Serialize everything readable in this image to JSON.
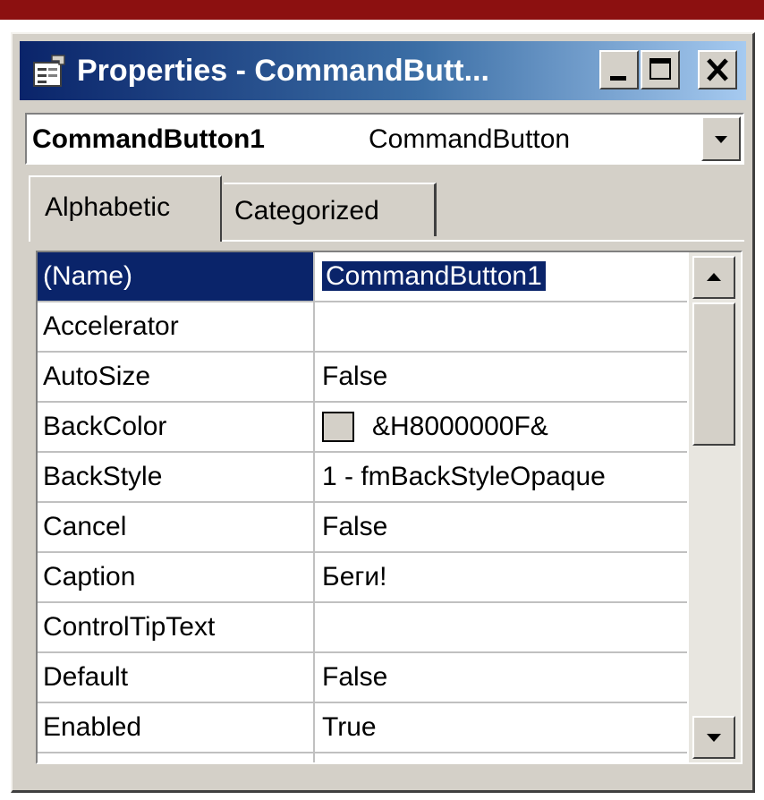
{
  "window": {
    "title": "Properties - CommandButt...",
    "controls": [
      "minimize-icon",
      "maximize-icon",
      "close-icon"
    ]
  },
  "object_selector": {
    "name": "CommandButton1",
    "type": "CommandButton"
  },
  "tabs": [
    {
      "label": "Alphabetic",
      "active": true
    },
    {
      "label": "Categorized",
      "active": false
    }
  ],
  "properties": [
    {
      "name": "(Name)",
      "value": "CommandButton1"
    },
    {
      "name": "Accelerator",
      "value": ""
    },
    {
      "name": "AutoSize",
      "value": "False"
    },
    {
      "name": "BackColor",
      "value": "&H8000000F&"
    },
    {
      "name": "BackStyle",
      "value": "1 - fmBackStyleOpaque"
    },
    {
      "name": "Cancel",
      "value": "False"
    },
    {
      "name": "Caption",
      "value": "Беги!"
    },
    {
      "name": "ControlTipText",
      "value": ""
    },
    {
      "name": "Default",
      "value": "False"
    },
    {
      "name": "Enabled",
      "value": "True"
    }
  ],
  "colors": {
    "accent_bar": "#8c1010",
    "title_gradient_start": "#0a246a",
    "title_gradient_end": "#a6caf0",
    "selection": "#0a246a",
    "chrome": "#d4d0c8",
    "backcolor_swatch": "#d4d0c8"
  }
}
